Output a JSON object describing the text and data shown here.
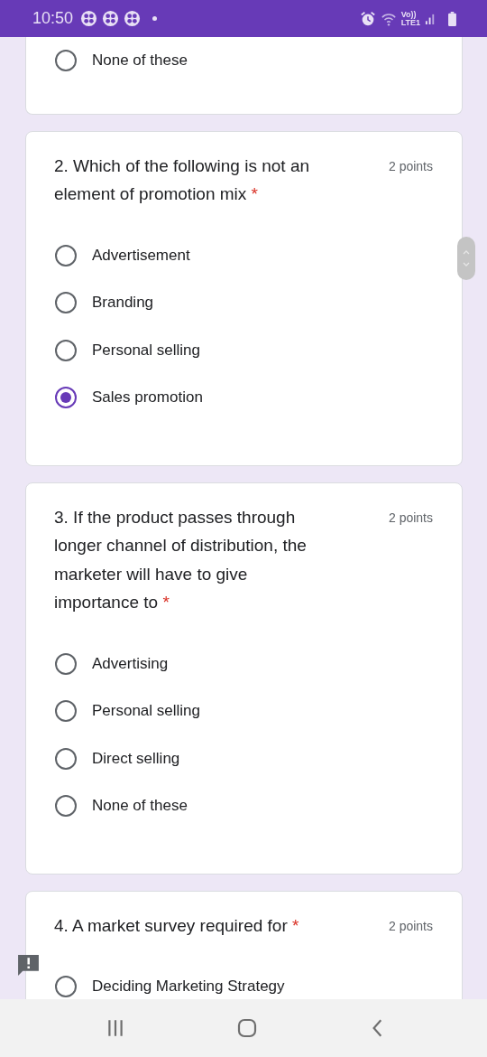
{
  "status_bar": {
    "time": "10:50",
    "volte": "Vo))",
    "network": "LTE1"
  },
  "questions": [
    {
      "options": [
        {
          "label": "None of these",
          "selected": false
        }
      ]
    },
    {
      "title": "2. Which of the following is not an element of promotion mix",
      "points": "2 points",
      "required": true,
      "options": [
        {
          "label": "Advertisement",
          "selected": false
        },
        {
          "label": "Branding",
          "selected": false
        },
        {
          "label": "Personal selling",
          "selected": false
        },
        {
          "label": "Sales promotion",
          "selected": true
        }
      ]
    },
    {
      "title": "3. If the product passes through longer channel of distribution, the marketer will have to give importance to",
      "points": "2 points",
      "required": true,
      "options": [
        {
          "label": "Advertising",
          "selected": false
        },
        {
          "label": "Personal selling",
          "selected": false
        },
        {
          "label": "Direct selling",
          "selected": false
        },
        {
          "label": "None of these",
          "selected": false
        }
      ]
    },
    {
      "title": "4. A market survey required for",
      "points": "2 points",
      "required": true,
      "options": [
        {
          "label": "Deciding Marketing Strategy",
          "selected": false
        }
      ]
    }
  ],
  "required_mark": "*"
}
